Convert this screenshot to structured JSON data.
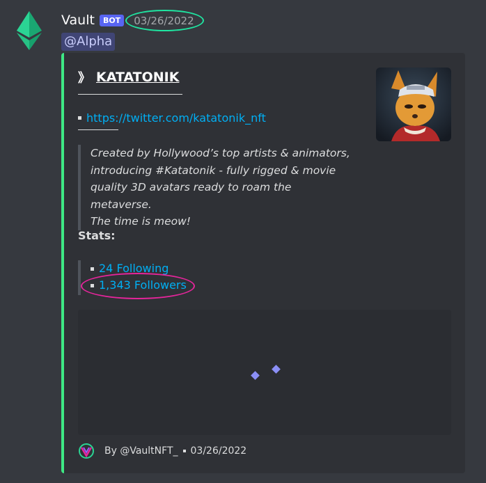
{
  "message": {
    "username": "Vault",
    "bot_tag": "BOT",
    "timestamp": "03/26/2022",
    "mention": "@Alpha"
  },
  "embed": {
    "accent_color": "#3ee884",
    "title_prefix": "》",
    "title": "KATATONIK",
    "twitter_link": "https://twitter.com/katatonik_nft",
    "quote_lines": [
      "Created by Hollywood’s top artists & animators,",
      "introducing #Katatonik - fully rigged & movie",
      "quality 3D avatars ready to roam the metaverse.",
      "The time is meow!"
    ],
    "stats_label": "Stats:",
    "stats": {
      "following": "24 Following",
      "followers": "1,343 Followers"
    },
    "footer": {
      "author": "By @VaultNFT_",
      "date": "03/26/2022"
    }
  },
  "colors": {
    "link": "#00aff4",
    "bot_tag": "#5865f2",
    "highlight_green": "#1fe5a1",
    "highlight_pink": "#e5259b"
  }
}
